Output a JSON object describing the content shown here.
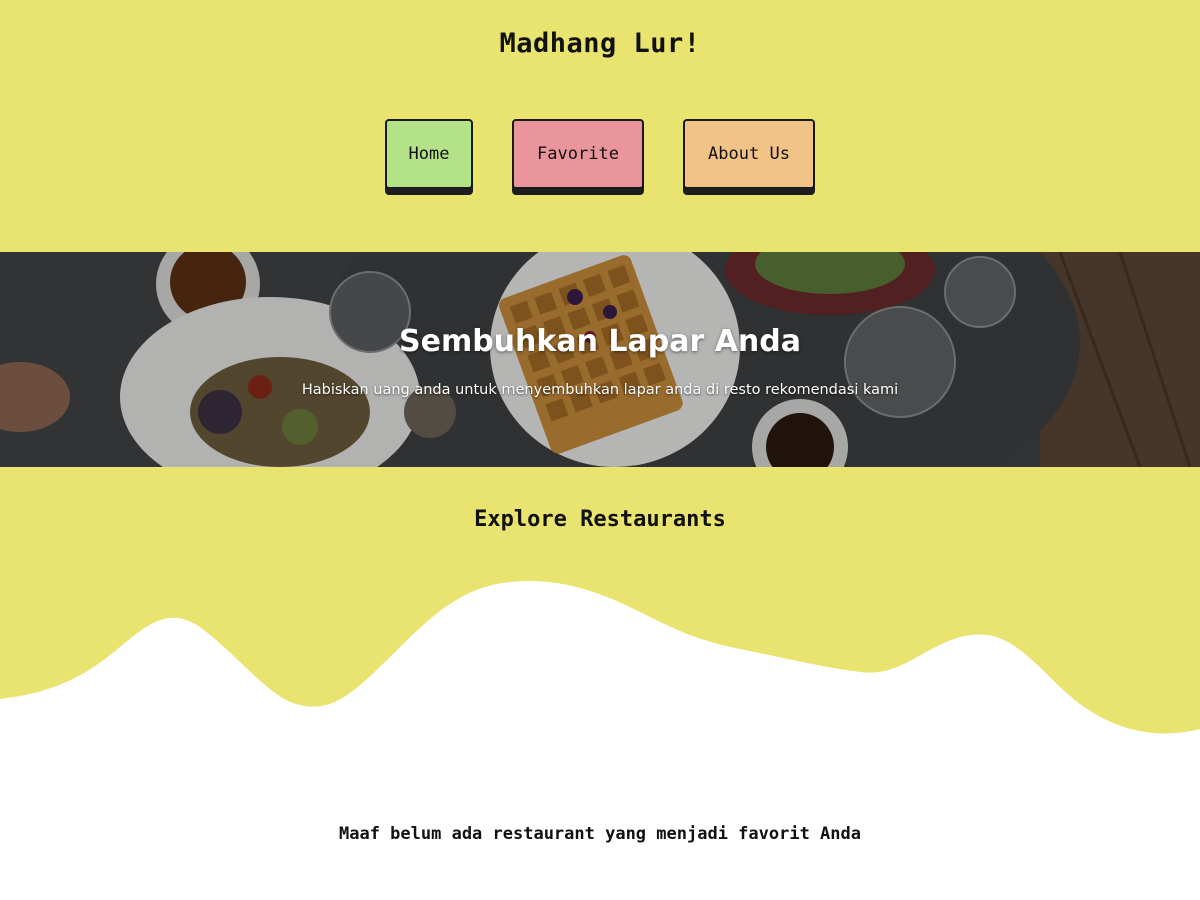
{
  "header": {
    "title": "Madhang Lur!",
    "nav": [
      {
        "label": "Home"
      },
      {
        "label": "Favorite"
      },
      {
        "label": "About Us"
      }
    ]
  },
  "hero": {
    "title": "Sembuhkan Lapar Anda",
    "subtitle": "Habiskan uang anda untuk menyembuhkan lapar anda di resto rekomendasi kami"
  },
  "explore": {
    "title": "Explore Restaurants",
    "empty_message": "Maaf belum ada restaurant yang menjadi favorit Anda"
  },
  "colors": {
    "header_background": "#e9e46f",
    "nav_home": "#b3e289",
    "nav_favorite": "#e9959b",
    "nav_about": "#f2c386",
    "page_background": "#ffffff"
  }
}
